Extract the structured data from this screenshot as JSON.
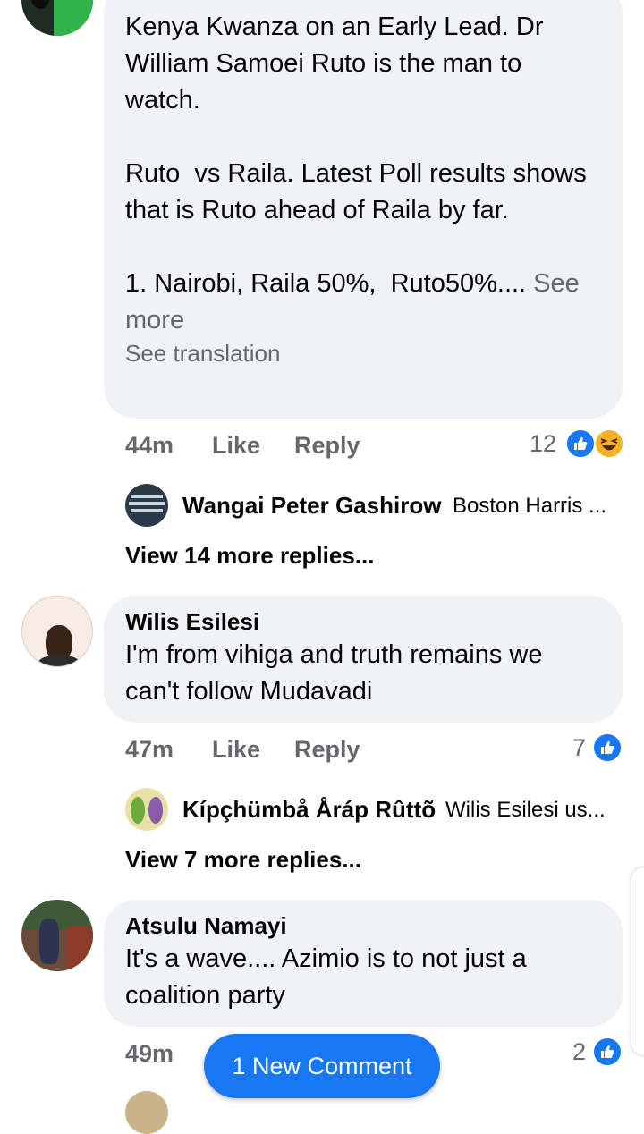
{
  "comments": [
    {
      "body": "Kenya Kwanza on an Early Lead. Dr William Samoei Ruto is the man to watch.\n\nRuto  vs Raila. Latest Poll results shows that is Ruto ahead of Raila by far.\n\n1. Nairobi, Raila 50%,  Ruto50%.... ",
      "see_more": "See more",
      "see_translation": "See translation",
      "time": "44m",
      "like": "Like",
      "reply": "Reply",
      "reaction_count": "12",
      "reactions": [
        "like-icon",
        "haha-icon"
      ],
      "reply_preview": {
        "name": "Wangai Peter Gashirow",
        "snippet": "Boston Harris ..."
      },
      "view_more": "View 14 more replies..."
    },
    {
      "name": "Wilis Esilesi",
      "body": "I'm from vihiga and truth remains we can't follow Mudavadi",
      "time": "47m",
      "like": "Like",
      "reply": "Reply",
      "reaction_count": "7",
      "reactions": [
        "like-icon"
      ],
      "reply_preview": {
        "name": "Kípçhümbå Åráp Rûttõ",
        "snippet": "Wilis Esilesi  us..."
      },
      "view_more": "View 7 more replies..."
    },
    {
      "name": "Atsulu Namayi",
      "body": "It's a wave.... Azimio is to not just a coalition party",
      "time": "49m",
      "reaction_count": "2",
      "reactions": [
        "like-icon"
      ]
    }
  ],
  "new_comment_button": "1 New Comment",
  "colors": {
    "accent": "#1877f2",
    "bubble": "#f0f2f5",
    "muted": "#65676b",
    "haha": "#f7b125"
  }
}
